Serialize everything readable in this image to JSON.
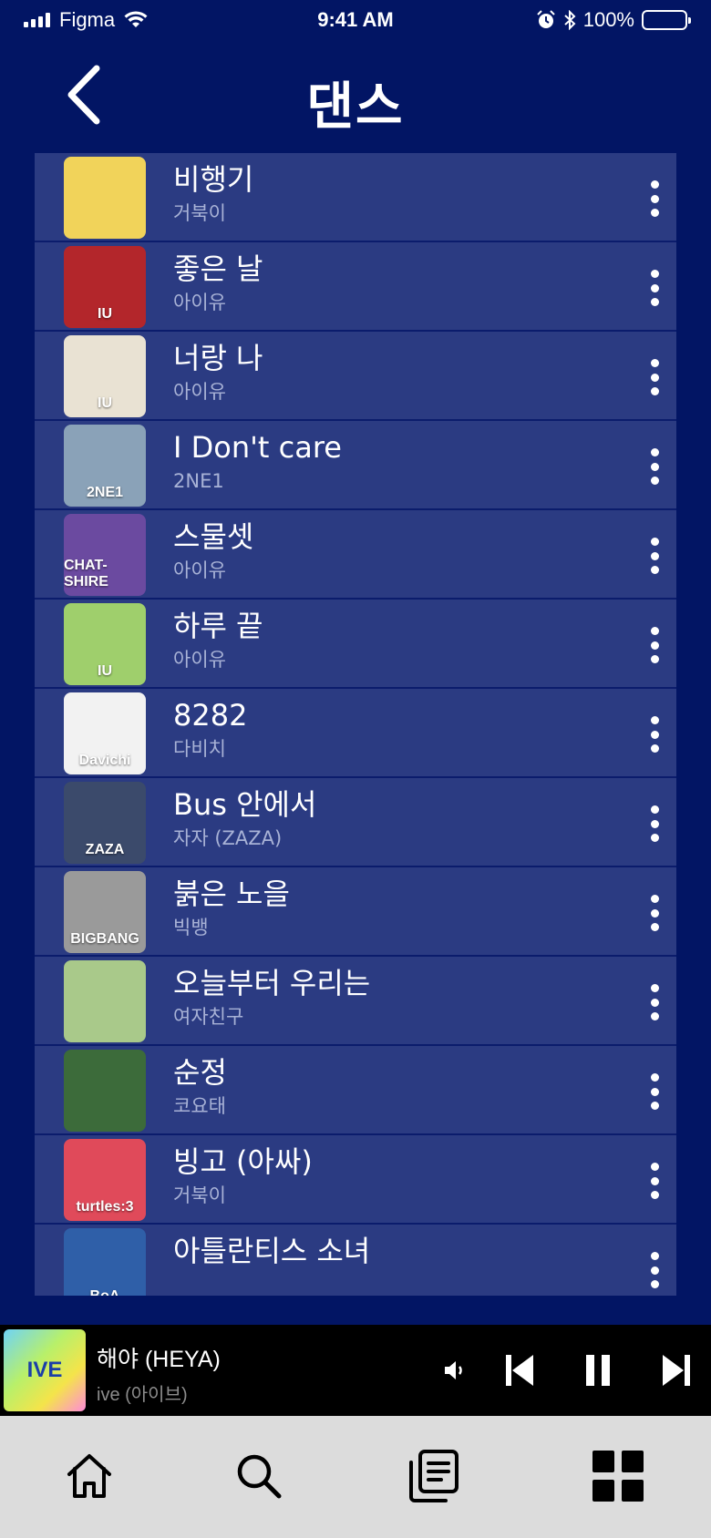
{
  "status_bar": {
    "carrier": "Figma",
    "time": "9:41 AM",
    "battery": "100%"
  },
  "header": {
    "title": "댄스"
  },
  "songs": [
    {
      "title": "비행기",
      "artist": "거북이",
      "art_bg": "#f1d35a",
      "art_text": ""
    },
    {
      "title": "좋은 날",
      "artist": "아이유",
      "art_bg": "#b3262b",
      "art_text": "IU"
    },
    {
      "title": "너랑 나",
      "artist": "아이유",
      "art_bg": "#e9e2d3",
      "art_text": "IU"
    },
    {
      "title": "I Don't care",
      "artist": "2NE1",
      "art_bg": "#8aa2b8",
      "art_text": "2NE1"
    },
    {
      "title": "스물셋",
      "artist": "아이유",
      "art_bg": "#6b4aa0",
      "art_text": "CHAT-SHIRE"
    },
    {
      "title": "하루 끝",
      "artist": "아이유",
      "art_bg": "#9fcf6c",
      "art_text": "IU"
    },
    {
      "title": "8282",
      "artist": "다비치",
      "art_bg": "#f2f2f2",
      "art_text": "Davichi"
    },
    {
      "title": "Bus 안에서",
      "artist": "자자 (ZAZA)",
      "art_bg": "#3b4a6b",
      "art_text": "ZAZA"
    },
    {
      "title": "붉은 노을",
      "artist": "빅뱅",
      "art_bg": "#9a9a9a",
      "art_text": "BIGBANG"
    },
    {
      "title": "오늘부터 우리는",
      "artist": "여자친구",
      "art_bg": "#a9c98a",
      "art_text": ""
    },
    {
      "title": "순정",
      "artist": "코요태",
      "art_bg": "#3c6b3a",
      "art_text": ""
    },
    {
      "title": "빙고 (아싸)",
      "artist": "거북이",
      "art_bg": "#e04a5a",
      "art_text": "turtles:3"
    },
    {
      "title": "아틀란티스 소녀",
      "artist": "",
      "art_bg": "#2f5fa8",
      "art_text": "BoA"
    }
  ],
  "mini_player": {
    "title": "해야 (HEYA)",
    "artist": "ive (아이브)",
    "art_text": "IVE"
  },
  "icons": {
    "back": "chevron-left-icon",
    "more": "more-vertical-icon",
    "volume": "volume-icon",
    "prev": "skip-back-icon",
    "pause": "pause-icon",
    "next": "skip-forward-icon",
    "home": "home-icon",
    "search": "search-icon",
    "library": "library-icon",
    "grid": "grid-icon"
  },
  "colors": {
    "background": "#021564",
    "row": "#2b3b82",
    "artist_text": "#a8b2d6",
    "player": "#000000",
    "tab_bar": "#dcdcdc"
  }
}
